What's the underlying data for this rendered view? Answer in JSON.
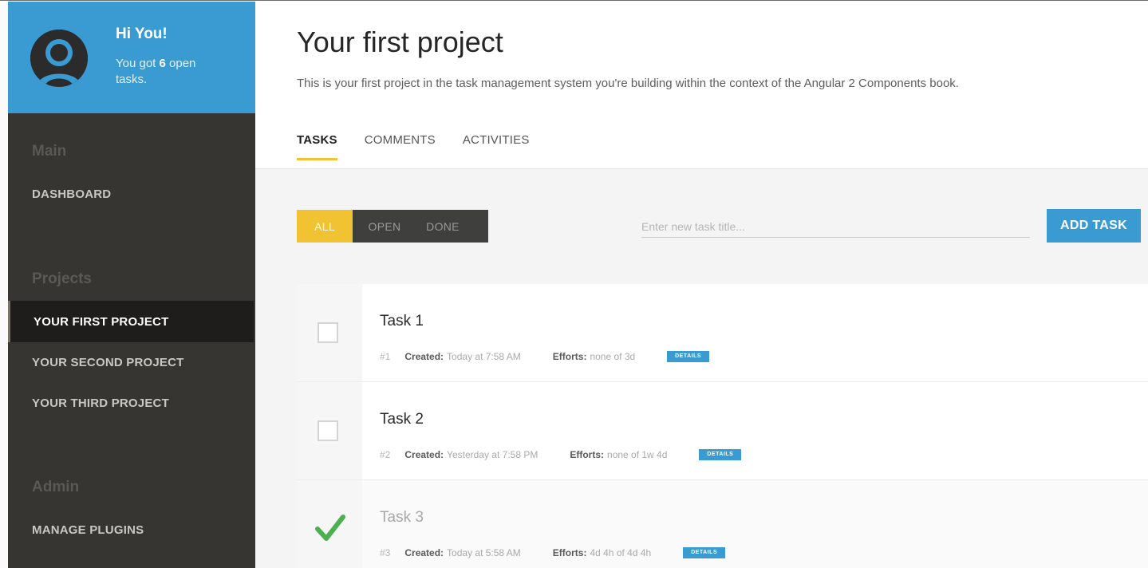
{
  "sidebar": {
    "greeting": "Hi You!",
    "open_prefix": "You got ",
    "open_count": "6",
    "open_suffix": " open tasks.",
    "sections": {
      "main": "Main",
      "projects": "Projects",
      "admin": "Admin"
    },
    "items": {
      "dashboard": "DASHBOARD",
      "project1": "YOUR FIRST PROJECT",
      "project2": "YOUR SECOND PROJECT",
      "project3": "YOUR THIRD PROJECT",
      "plugins": "MANAGE PLUGINS"
    }
  },
  "header": {
    "title": "Your first project",
    "description": "This is your first project in the task management system you're building within the context of the Angular 2 Components book.",
    "tabs": [
      "TASKS",
      "COMMENTS",
      "ACTIVITIES"
    ]
  },
  "toolbar": {
    "filters": [
      "ALL",
      "OPEN",
      "DONE"
    ],
    "input_placeholder": "Enter new task title...",
    "add_label": "ADD TASK"
  },
  "tasks": [
    {
      "title": "Task 1",
      "number": "#1",
      "created_label": "Created:",
      "created": "Today at 7:58 AM",
      "efforts_label": "Efforts:",
      "efforts": "none of 3d",
      "details_label": "DETAILS",
      "done": false
    },
    {
      "title": "Task 2",
      "number": "#2",
      "created_label": "Created:",
      "created": "Yesterday at 7:58 PM",
      "efforts_label": "Efforts:",
      "efforts": "none of 1w 4d",
      "details_label": "DETAILS",
      "done": false
    },
    {
      "title": "Task 3",
      "number": "#3",
      "created_label": "Created:",
      "created": "Today at 5:58 AM",
      "efforts_label": "Efforts:",
      "efforts": "4d 4h of 4d 4h",
      "details_label": "DETAILS",
      "done": true
    }
  ],
  "colors": {
    "accent_blue": "#3a9bd2",
    "accent_yellow": "#f1c232",
    "sidebar_bg": "#363532",
    "check_green": "#4caf50"
  },
  "icons": {
    "avatar": "user-silhouette-icon",
    "check": "checkmark-icon"
  }
}
